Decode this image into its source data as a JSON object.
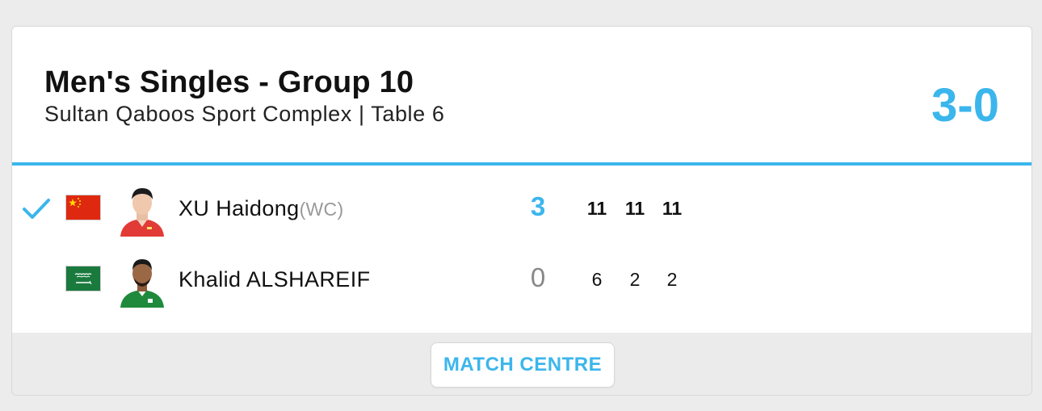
{
  "match": {
    "title": "Men's Singles - Group 10",
    "venue": "Sultan Qaboos Sport Complex | Table 6",
    "overall_score": "3-0"
  },
  "players": [
    {
      "name": "XU Haidong",
      "tag": "(WC)",
      "flag_icon": "china-flag-icon",
      "winner": true,
      "sets_won": "3",
      "games": [
        "11",
        "11",
        "11"
      ]
    },
    {
      "name": "Khalid ALSHAREIF",
      "tag": "",
      "flag_icon": "saudi-arabia-flag-icon",
      "winner": false,
      "sets_won": "0",
      "games": [
        "6",
        "2",
        "2"
      ]
    }
  ],
  "footer": {
    "match_centre_label": "MATCH CENTRE"
  },
  "colors": {
    "accent": "#3bb6ec",
    "china_red": "#de2910",
    "china_yellow": "#ffde00",
    "saudi_green": "#1a7a3e"
  }
}
